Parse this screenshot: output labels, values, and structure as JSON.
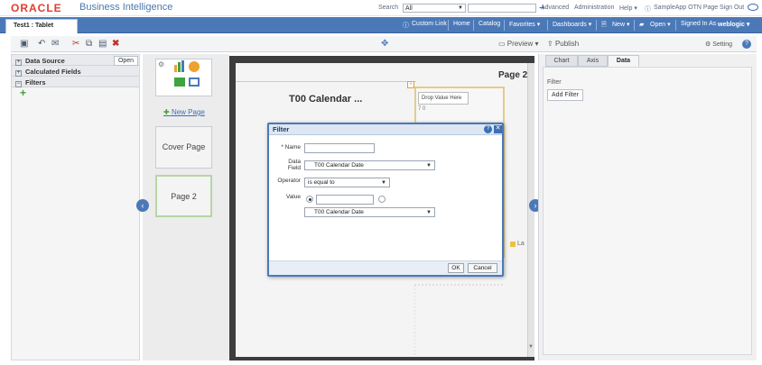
{
  "header": {
    "brand_oracle": "ORACLE",
    "brand_bi": "Business Intelligence",
    "search_label": "Search",
    "search_scope": "All",
    "links": [
      "Advanced",
      "Administration",
      "Help ▾",
      "SampleApp OTN Page",
      "Sign Out"
    ]
  },
  "tab": {
    "title": "Test1 : Tablet"
  },
  "nav": {
    "items": [
      "Custom Link",
      "Home",
      "Catalog",
      "Favorites ▾",
      "Dashboards ▾",
      "New ▾",
      "Open ▾"
    ],
    "signed_in_prefix": "Signed In As",
    "user": "weblogic ▾"
  },
  "toolbar": {
    "preview_label": "Preview ▾",
    "publish_label": "Publish",
    "setting_label": "Setting",
    "help_label": "?"
  },
  "data_panel": {
    "items": [
      "Data Source",
      "Calculated Fields",
      "Filters"
    ],
    "open_label": "Open"
  },
  "thumbs": {
    "new_page_label": "New Page",
    "pages": [
      "Cover Page",
      "Page 2"
    ]
  },
  "canvas": {
    "calendar_title": "T00 Calendar ...",
    "page_label": "Page 2",
    "drop_value_label": "Drop Value Here",
    "legend_fragment": "La"
  },
  "props": {
    "tabs": [
      "Chart",
      "Axis",
      "Data"
    ],
    "active_tab": "Data",
    "filter_label": "Filter",
    "add_filter_label": "Add Filter"
  },
  "modal": {
    "title": "Filter",
    "name_label": "* Name",
    "name_value": "",
    "data_field_label_1": "Data",
    "data_field_label_2": "Field",
    "data_field_value": "T00 Calendar Date",
    "operator_label": "Operator",
    "operator_value": "is equal to",
    "value_label": "Value",
    "value_input": "",
    "value_field_select": "T00 Calendar Date",
    "ok_label": "OK",
    "cancel_label": "Cancel"
  },
  "colors": {
    "oracle_red": "#e03c31",
    "nav_blue": "#4b79b8",
    "accent_green": "#3fa33f"
  }
}
